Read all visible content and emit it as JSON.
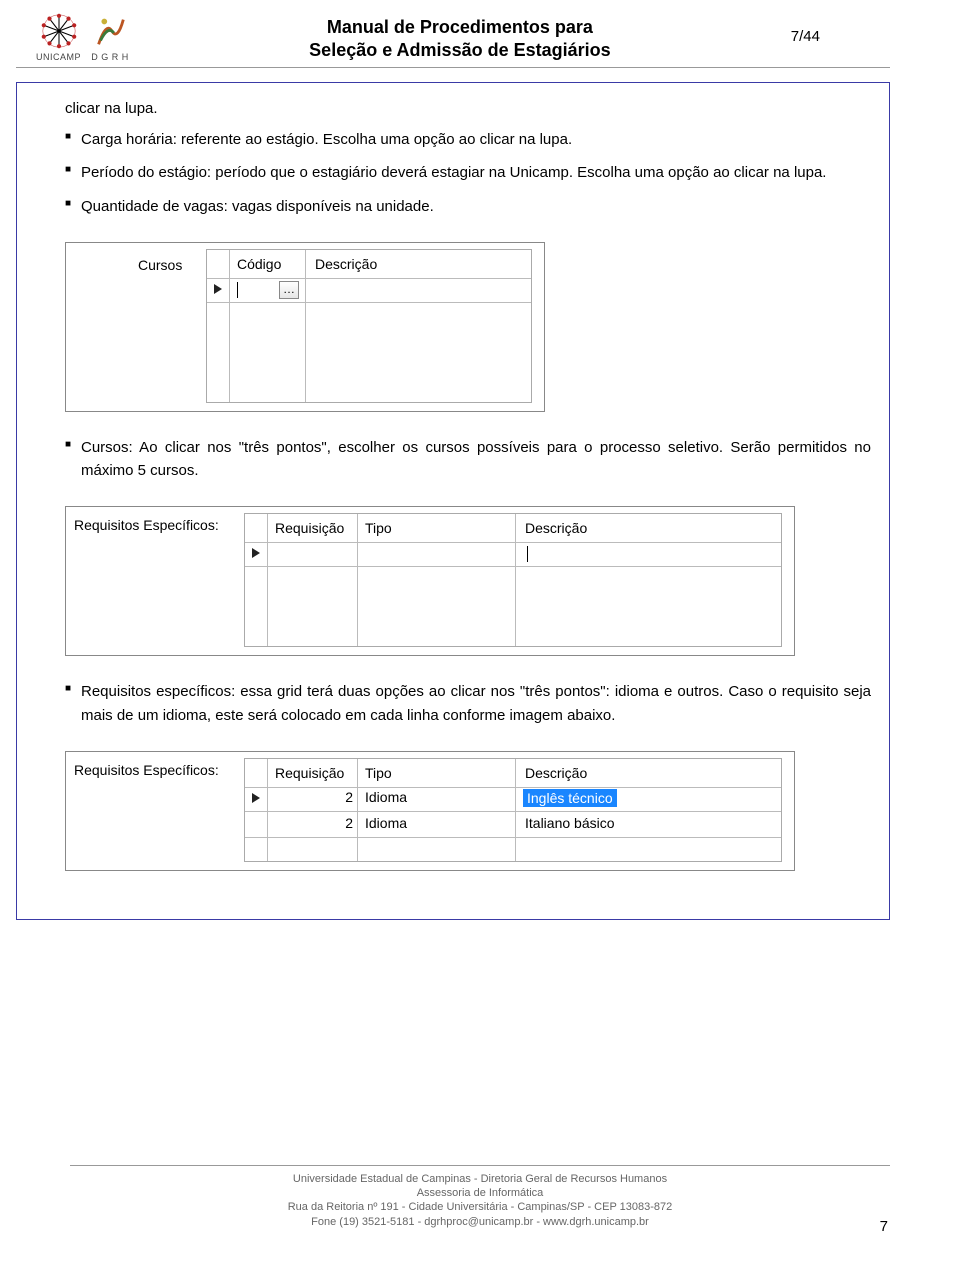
{
  "header": {
    "title_l1": "Manual de Procedimentos para",
    "title_l2": "Seleção e Admissão de Estagiários",
    "page_label": "7/44",
    "logo_unicamp_label": "UNICAMP",
    "logo_dgrh_label": "D G R H"
  },
  "bullets_top": {
    "lead": "clicar na lupa.",
    "b1": "Carga horária: referente ao estágio. Escolha uma opção ao clicar na lupa.",
    "b2": "Período do estágio: período que o estagiário deverá estagiar na Unicamp. Escolha uma opção ao clicar na lupa.",
    "b3": "Quantidade de vagas: vagas disponíveis na unidade."
  },
  "fig1": {
    "label": "Cursos",
    "col_codigo": "Código",
    "col_descricao": "Descrição",
    "dots": "…"
  },
  "bullets_mid": {
    "b1": "Cursos: Ao clicar nos \"três pontos\", escolher os cursos possíveis para o processo seletivo. Serão permitidos no máximo 5 cursos."
  },
  "fig2": {
    "label": "Requisitos Específicos:",
    "col_req": "Requisição",
    "col_tipo": "Tipo",
    "col_desc": "Descrição"
  },
  "bullets_bot": {
    "b1": "Requisitos específicos: essa grid terá duas opções ao clicar nos \"três pontos\": idioma e outros. Caso o requisito seja mais de um idioma, este será colocado em cada linha conforme imagem abaixo."
  },
  "fig3": {
    "label": "Requisitos Específicos:",
    "col_req": "Requisição",
    "col_tipo": "Tipo",
    "col_desc": "Descrição",
    "r1_req": "2",
    "r1_tipo": "Idioma",
    "r1_desc": "Inglês técnico",
    "r2_req": "2",
    "r2_tipo": "Idioma",
    "r2_desc": "Italiano básico"
  },
  "footer": {
    "l1": "Universidade Estadual de Campinas - Diretoria Geral de Recursos Humanos",
    "l2": "Assessoria de Informática",
    "l3": "Rua da Reitoria nº 191 - Cidade Universitária - Campinas/SP - CEP 13083-872",
    "l4": "Fone (19) 3521-5181 - dgrhproc@unicamp.br - www.dgrh.unicamp.br",
    "page": "7"
  }
}
